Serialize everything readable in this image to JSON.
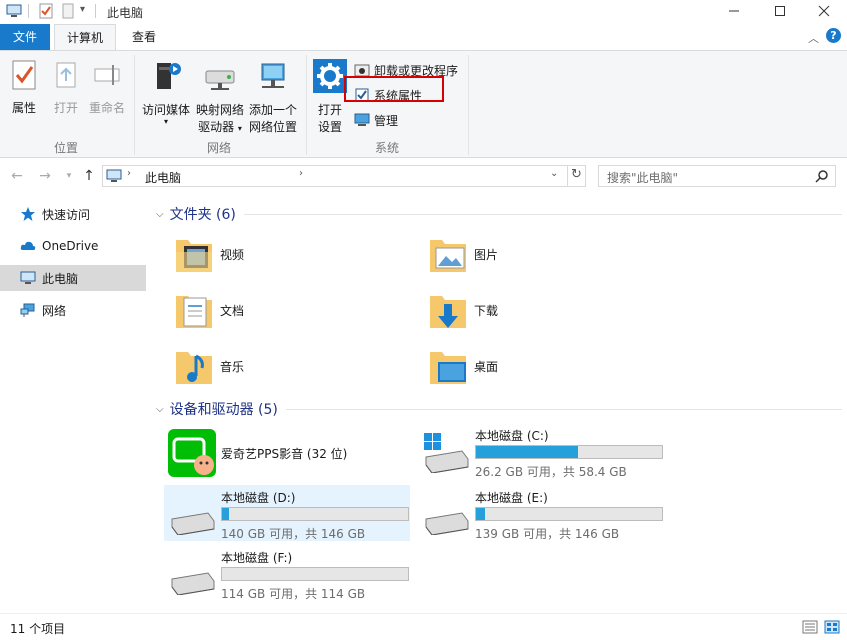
{
  "window": {
    "title": "此电脑",
    "minimize_label": "—",
    "maximize_label": "□",
    "close_label": "✕"
  },
  "tabs": {
    "file": "文件",
    "computer": "计算机",
    "view": "查看"
  },
  "ribbon": {
    "location": {
      "label": "位置",
      "properties": "属性",
      "open": "打开",
      "rename": "重命名"
    },
    "network": {
      "label": "网络",
      "access_media": "访问媒体",
      "map_drive_1": "映射网络",
      "map_drive_2": "驱动器",
      "add_location_1": "添加一个",
      "add_location_2": "网络位置"
    },
    "system": {
      "label": "系统",
      "open_settings_1": "打开",
      "open_settings_2": "设置",
      "uninstall": "卸载或更改程序",
      "system_properties": "系统属性",
      "manage": "管理"
    }
  },
  "address": {
    "path": "此电脑",
    "search_placeholder": "搜索\"此电脑\""
  },
  "sidebar": {
    "items": [
      {
        "label": "快速访问"
      },
      {
        "label": "OneDrive"
      },
      {
        "label": "此电脑"
      },
      {
        "label": "网络"
      }
    ]
  },
  "folders_section": {
    "title": "文件夹 (6)",
    "items": [
      {
        "label": "视频"
      },
      {
        "label": "图片"
      },
      {
        "label": "文档"
      },
      {
        "label": "下载"
      },
      {
        "label": "音乐"
      },
      {
        "label": "桌面"
      }
    ]
  },
  "drives_section": {
    "title": "设备和驱动器 (5)",
    "app": {
      "label": "爱奇艺PPS影音 (32 位)"
    },
    "drives": [
      {
        "name": "本地磁盘 (C:)",
        "free": "26.2 GB 可用，共 58.4 GB",
        "used_fraction": 0.55
      },
      {
        "name": "本地磁盘 (D:)",
        "free": "140 GB 可用，共 146 GB",
        "used_fraction": 0.04
      },
      {
        "name": "本地磁盘 (E:)",
        "free": "139 GB 可用，共 146 GB",
        "used_fraction": 0.05
      },
      {
        "name": "本地磁盘 (F:)",
        "free": "114 GB 可用，共 114 GB",
        "used_fraction": 0.0
      }
    ]
  },
  "status": {
    "item_count": "11 个项目"
  },
  "colors": {
    "accent": "#1979ca",
    "drive_fill": "#26a0da",
    "highlight_box": "#d80000",
    "section_title": "#1e3287"
  }
}
